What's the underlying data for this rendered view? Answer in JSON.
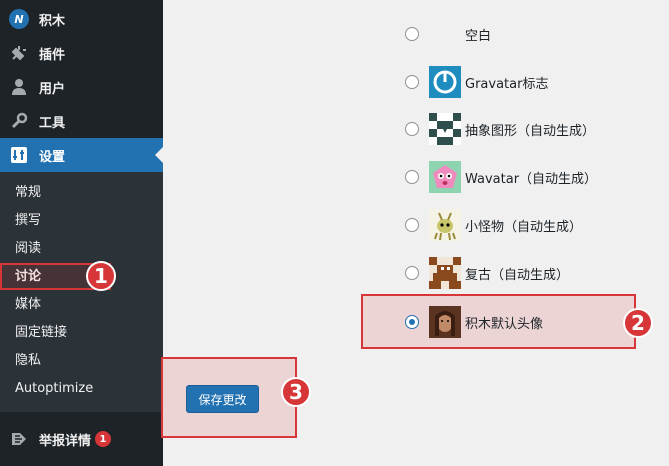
{
  "sidebar": {
    "top_item": {
      "label": "积木",
      "icon": "site-logo-icon"
    },
    "menu": [
      {
        "label": "插件",
        "icon": "plugin-icon"
      },
      {
        "label": "用户",
        "icon": "user-icon"
      },
      {
        "label": "工具",
        "icon": "wrench-icon"
      },
      {
        "label": "设置",
        "icon": "settings-icon"
      }
    ],
    "submenu": [
      "常规",
      "撰写",
      "阅读",
      "讨论",
      "媒体",
      "固定链接",
      "隐私",
      "Autoptimize"
    ],
    "report": {
      "label": "举报详情",
      "badge": "1"
    }
  },
  "avatars": [
    {
      "label": "空白"
    },
    {
      "label": "Gravatar标志"
    },
    {
      "label": "抽象图形（自动生成）"
    },
    {
      "label": "Wavatar（自动生成）"
    },
    {
      "label": "小怪物（自动生成）"
    },
    {
      "label": "复古（自动生成）"
    },
    {
      "label": "积木默认头像"
    }
  ],
  "save_button": "保存更改",
  "markers": [
    "1",
    "2",
    "3"
  ],
  "colors": {
    "accent": "#2271b1",
    "highlight": "#d63638",
    "sidebar": "#1d2327"
  }
}
